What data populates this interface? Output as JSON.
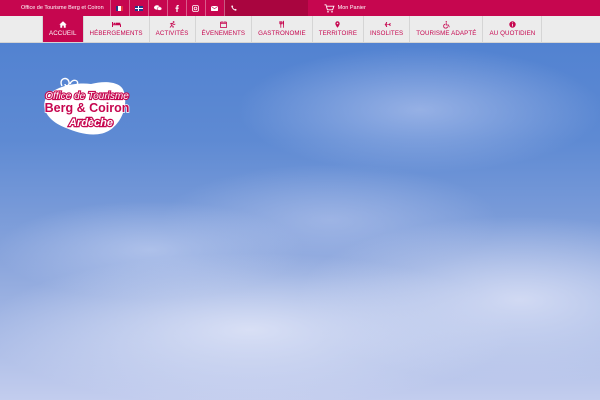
{
  "topbar": {
    "brand": "Office de Tourisme Berg et Coiron",
    "icons": [
      "french-flag-icon",
      "uk-flag-icon",
      "chat-icon",
      "facebook-icon",
      "instagram-icon",
      "mail-icon",
      "phone-icon"
    ],
    "cart_label": "Mon Panier",
    "colors": {
      "primary": "#c6064f",
      "phone_bg": "#a9053f"
    }
  },
  "nav": {
    "items": [
      {
        "label": "ACCUEIL",
        "icon": "home-icon",
        "active": true
      },
      {
        "label": "HÉBERGEMENTS",
        "icon": "bed-icon"
      },
      {
        "label": "ACTIVITÉS",
        "icon": "activity-icon"
      },
      {
        "label": "ÉVENEMENTS",
        "icon": "calendar-icon"
      },
      {
        "label": "GASTRONOMIE",
        "icon": "cutlery-icon"
      },
      {
        "label": "TERRITOIRE",
        "icon": "map-marker-icon"
      },
      {
        "label": "INSOLITES",
        "icon": "plane-icon"
      },
      {
        "label": "TOURISME ADAPTÉ",
        "icon": "wheelchair-icon"
      },
      {
        "label": "AU QUOTIDIEN",
        "icon": "info-icon"
      }
    ]
  },
  "logo": {
    "line1": "Office de Tourisme",
    "line2": "Berg & Coiron",
    "line3": "Ardèche"
  }
}
